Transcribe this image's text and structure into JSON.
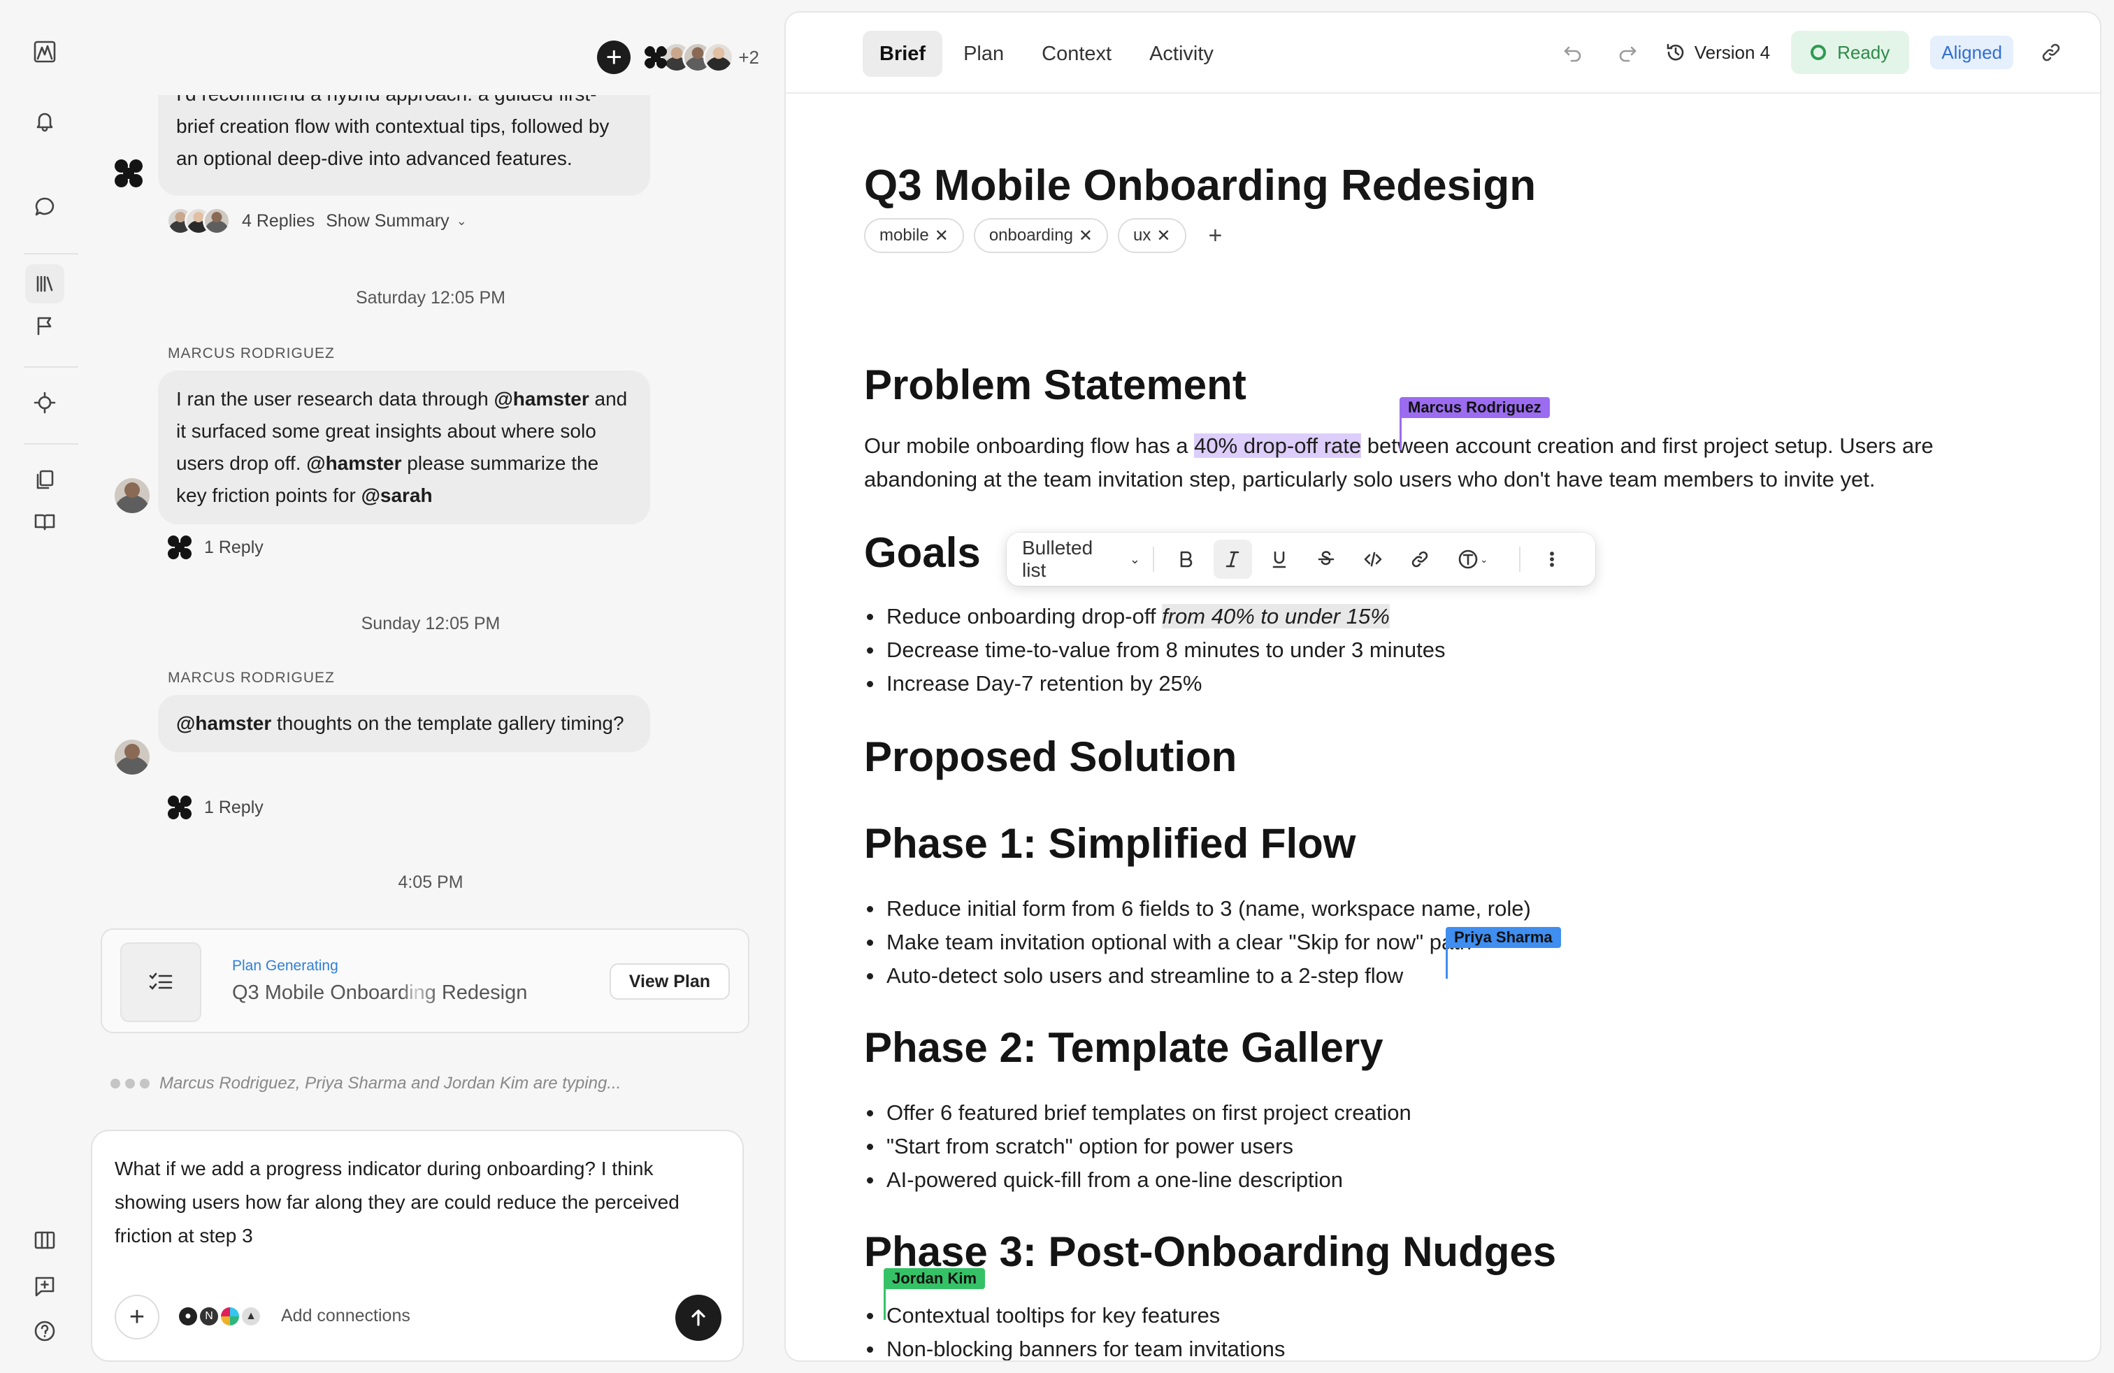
{
  "chat": {
    "first_message": "I'd recommend a hybrid approach: a guided first-brief creation flow with contextual tips, followed by an optional deep-dive into advanced features.",
    "first_message_replies": "4 Replies",
    "show_summary": "Show Summary",
    "avatar_overflow": "+2",
    "sep_saturday": "Saturday 12:05 PM",
    "msg2_sender": "MARCUS RODRIGUEZ",
    "msg2_parts": {
      "a": "I ran the user research data through ",
      "m1": "@hamster",
      "b": " and it surfaced some great insights about where solo users drop off. ",
      "m2": "@hamster",
      "c": " please summarize the key friction points for ",
      "m3": "@sarah"
    },
    "msg2_replies": "1 Reply",
    "sep_sunday": "Sunday 12:05 PM",
    "msg3_sender": "MARCUS RODRIGUEZ",
    "msg3_parts": {
      "m1": "@hamster",
      "a": " thoughts on the template gallery timing?"
    },
    "msg3_replies": "1 Reply",
    "sep_time": "4:05 PM",
    "plan_card": {
      "status": "Plan Generating",
      "title": "Q3 Mobile Onboarding Redesign",
      "button": "View Plan"
    },
    "typing": "Marcus Rodriguez, Priya Sharma and Jordan Kim are typing...",
    "composer": {
      "text": "What if we add a progress indicator during onboarding? I think showing users how far along they are could reduce the perceived friction at step 3",
      "add_connections": "Add connections"
    }
  },
  "doc": {
    "tabs": [
      "Brief",
      "Plan",
      "Context",
      "Activity"
    ],
    "active_tab": "Brief",
    "version": "Version 4",
    "status_ready": "Ready",
    "status_aligned": "Aligned",
    "title": "Q3 Mobile Onboarding Redesign",
    "tags": [
      "mobile",
      "onboarding",
      "ux"
    ],
    "problem_heading": "Problem Statement",
    "problem_parts": {
      "a": "Our mobile onboarding flow has a ",
      "hl": "40% drop-off rate",
      "b": " between account creation and first project setup. Users are abandoning at the team invitation step, particularly solo users who don't have team members to invite yet."
    },
    "goals_heading": "Goals",
    "goal1_a": "Reduce onboarding drop-off ",
    "goal1_hl": "from 40% to under 15%",
    "goals_rest": [
      "Decrease time-to-value from 8 minutes to under 3 minutes",
      "Increase Day-7 retention by 25%"
    ],
    "solution_heading": "Proposed Solution",
    "phase1_heading": "Phase 1: Simplified Flow",
    "phase1_item1": "Reduce initial form from 6 fields to 3 (name, workspace name, role)",
    "phase1_item2_a": "Make team invitation ",
    "phase1_item2_b": "optional",
    "phase1_item2_c": " with a clear \"Skip for now\" path",
    "phase1_item3": "Auto-detect solo users and streamline to a 2-step flow",
    "phase2_heading": "Phase 2: Template Gallery",
    "phase2_items": [
      "Offer 6 featured brief templates on first project creation",
      "\"Start from scratch\" option for power users",
      "AI-powered quick-fill from a one-line description"
    ],
    "phase3_heading": "Phase 3: Post-Onboarding Nudges",
    "phase3_items": [
      "Contextual tooltips for key features",
      "Non-blocking banners for team invitations"
    ],
    "cursors": [
      {
        "name": "Marcus Rodriguez",
        "color": "#9b6cf0"
      },
      {
        "name": "Priya Sharma",
        "color": "#3f8ef0"
      },
      {
        "name": "Jordan Kim",
        "color": "#35c267"
      }
    ],
    "format_toolbar": {
      "block_type": "Bulleted list"
    }
  }
}
